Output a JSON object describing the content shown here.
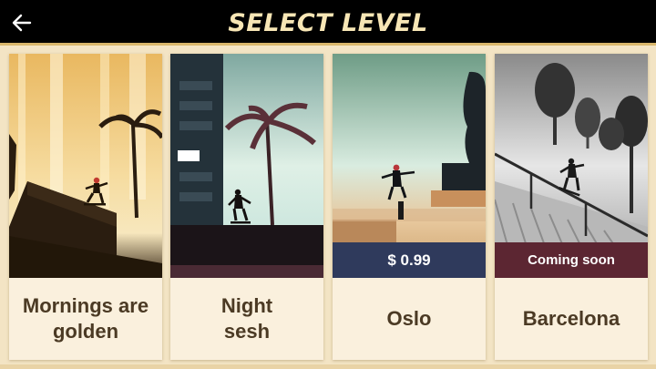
{
  "header": {
    "title": "SELECT LEVEL",
    "back_icon": "arrow-left-icon"
  },
  "levels": [
    {
      "name": "Mornings are\ngolden",
      "badge": ""
    },
    {
      "name": "Night\nsesh",
      "badge": ""
    },
    {
      "name": "Oslo",
      "badge": "$ 0.99"
    },
    {
      "name": "Barcelona",
      "badge": "Coming soon"
    }
  ],
  "colors": {
    "header_bg": "#000000",
    "title": "#f7e6b5",
    "page_bg": "#f3e4c4",
    "price_badge": "#2f3a5c",
    "soon_badge": "#5c2632",
    "label_text": "#4b3a24"
  }
}
